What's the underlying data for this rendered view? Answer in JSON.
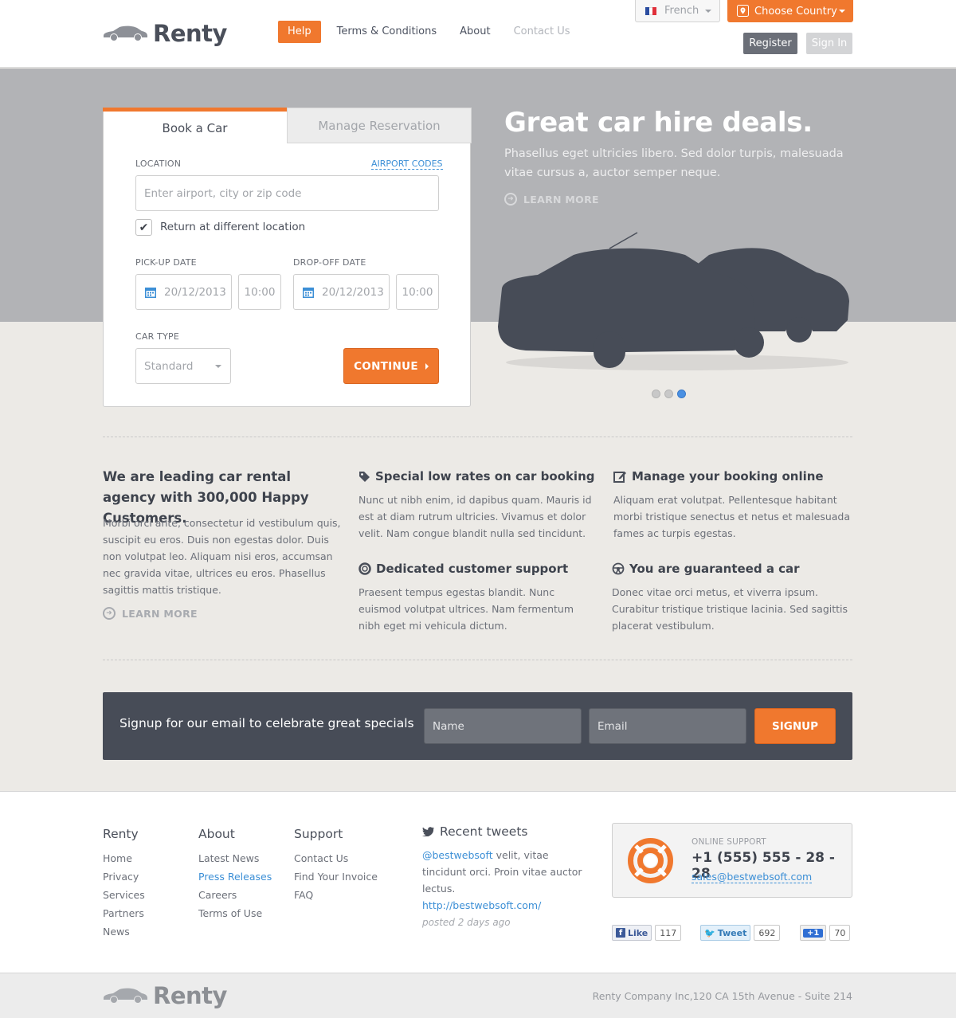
{
  "header": {
    "brand": "Renty",
    "nav": [
      {
        "label": "Help",
        "active": true
      },
      {
        "label": "Terms & Conditions"
      },
      {
        "label": "About"
      },
      {
        "label": "Contact Us",
        "muted": true
      }
    ],
    "language": "French",
    "country_label": "Choose Country",
    "register_label": "Register",
    "signin_label": "Sign In",
    "accent_color": "#f0782e"
  },
  "booking": {
    "tabs": [
      "Book a Car",
      "Manage Reservation"
    ],
    "location_label": "LOCATION",
    "airport_codes": "AIRPORT CODES",
    "location_placeholder": "Enter airport, city or zip code",
    "return_label": "Return at different location",
    "return_checked": true,
    "pickup_label": "PICK-UP DATE",
    "pickup_date": "20/12/2013",
    "pickup_time": "10:00",
    "dropoff_label": "DROP-OFF DATE",
    "dropoff_date": "20/12/2013",
    "dropoff_time": "10:00",
    "car_type_label": "CAR TYPE",
    "car_type": "Standard",
    "continue_label": "CONTINUE"
  },
  "hero": {
    "title": "Great car hire deals.",
    "text": "Phasellus eget ultricies libero. Sed dolor turpis, malesuada vitae cursus a, auctor semper neque.",
    "learn_more": "LEARN MORE",
    "slides": 3,
    "active_slide": 3
  },
  "about": {
    "title": "We are leading car rental agency with 300,000 Happy Customers.",
    "text": "Morbi orci ante, consectetur id vestibulum quis, suscipit eu eros. Duis non egestas dolor. Duis non volutpat leo. Aliquam nisi eros, accumsan nec gravida vitae, ultrices eu eros. Phasellus sagittis mattis tristique.",
    "learn_more": "LEARN MORE"
  },
  "features": [
    {
      "icon": "tag-icon",
      "title": "Special low rates on car booking",
      "text": "Nunc ut nibh enim, id dapibus quam. Mauris id est at diam rutrum ultricies. Vivamus et dolor velit. Nam congue blandit nulla sed tincidunt."
    },
    {
      "icon": "edit-icon",
      "title": "Manage your booking online",
      "text": "Aliquam erat volutpat. Pellentesque habitant morbi tristique senectus et netus et malesuada fames ac turpis egestas."
    },
    {
      "icon": "lifebuoy-icon",
      "title": "Dedicated customer support",
      "text": "Praesent tempus egestas blandit. Nunc euismod volutpat ultrices. Nam fermentum nibh eget mi vehicula dictum."
    },
    {
      "icon": "steering-wheel-icon",
      "title": "You are guaranteed a car",
      "text": "Donec vitae orci metus, et viverra ipsum. Curabitur tristique tristique lacinia. Sed sagittis placerat vestibulum."
    }
  ],
  "signup": {
    "text": "Signup for our email to celebrate great specials",
    "name_placeholder": "Name",
    "email_placeholder": "Email",
    "button": "SIGNUP"
  },
  "footer": {
    "columns": [
      {
        "title": "Renty",
        "links": [
          "Home",
          "Privacy",
          "Services",
          "Partners",
          "News"
        ]
      },
      {
        "title": "About",
        "links": [
          "Latest News",
          "Press Releases",
          "Careers",
          "Terms of Use"
        ]
      },
      {
        "title": "Support",
        "links": [
          "Contact Us",
          "Find Your Invoice",
          "FAQ"
        ]
      }
    ],
    "tweets": {
      "title": "Recent tweets",
      "handle": "@bestwebsoft",
      "text": " velit, vitae tincidunt orci. Proin vitae auctor lectus.",
      "url": "http://bestwebsoft.com/",
      "time": "posted 2 days ago"
    },
    "support": {
      "label": "ONLINE SUPPORT",
      "phone": "+1 (555) 555 - 28 - 28",
      "email": "sales@bestwebsoft.com"
    },
    "social": {
      "like_label": "Like",
      "like_count": "117",
      "tweet_label": "Tweet",
      "tweet_count": "692",
      "plus_label": "+1",
      "plus_count": "70"
    },
    "brand": "Renty",
    "copyright": "Renty Company Inc,120 CA 15th Avenue - Suite 214"
  }
}
